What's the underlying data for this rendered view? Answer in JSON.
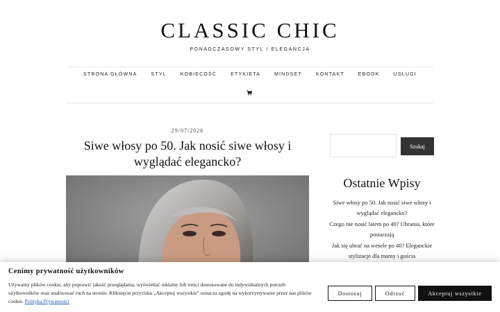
{
  "site": {
    "logo": "CLASSIC CHIC",
    "tagline": "PONADCZASOWY STYL I ELEGANCJA"
  },
  "nav": {
    "items": [
      "STRONA GŁÓWNA",
      "STYL",
      "KOBIECOŚĆ",
      "ETYKIETA",
      "MINDSET",
      "KONTAKT",
      "EBOOK",
      "USŁUGI"
    ],
    "cart_icon": "cart-icon"
  },
  "post": {
    "date": "29/07/2026",
    "title": "Siwe włosy po 50. Jak nosić siwe włosy i wyglądać elegancko?"
  },
  "sidebar": {
    "search_placeholder": "",
    "search_button": "Szukaj",
    "recent_title": "Ostatnie Wpisy",
    "recent_posts": [
      "Siwe włosy po 50. Jak nosić siwe włosy i wyglądać elegancko?",
      "Czego nie nosić latem po 40? Ubrania, które postarzają",
      "Jak się ubrać na wesele po 40? Eleganckie stylizacje dla mamy i gościa"
    ]
  },
  "cookie": {
    "title": "Cenimy prywatność użytkowników",
    "text": "Używamy plików cookie, aby poprawić jakość przeglądania, wyświetlać reklamy lub treści dostosowane do indywidualnych potrzeb użytkowników oraz analizować ruch na stronie. Kliknięcie przycisku „Akceptuj wszystkie\" oznacza zgodę na wykorzystywanie przez nas plików cookie.",
    "link": "Polityka Prywatności",
    "customize": "Dostosuj",
    "reject": "Odrzuć",
    "accept": "Akceptuj wszystkie"
  }
}
